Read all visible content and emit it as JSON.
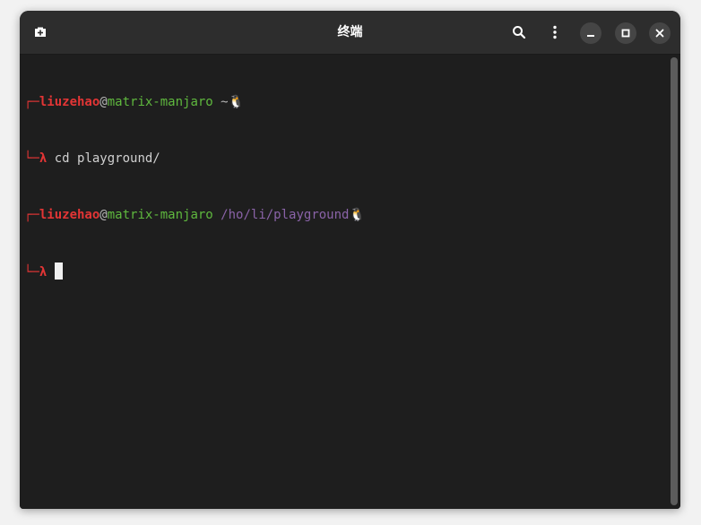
{
  "window": {
    "title": "终端"
  },
  "headerbar": {
    "new_tab_icon": "new-tab-icon",
    "search_icon": "search-icon",
    "menu_icon": "kebab-menu-icon",
    "minimize_icon": "minimize-icon",
    "maximize_icon": "maximize-icon",
    "close_icon": "close-icon"
  },
  "terminal": {
    "lines": [
      {
        "corner": "┌─",
        "user": "liuzehao",
        "at": "@",
        "host": "matrix-manjaro",
        "path": " ~",
        "suffix": "🐧"
      },
      {
        "corner": "└─",
        "prompt": "λ",
        "command": " cd playground/"
      },
      {
        "corner": "┌─",
        "user": "liuzehao",
        "at": "@",
        "host": "matrix-manjaro",
        "path": " /ho/li/playground",
        "suffix": "🐧"
      },
      {
        "corner": "└─",
        "prompt": "λ",
        "command": " "
      }
    ]
  },
  "colors": {
    "user": "#e23535",
    "host": "#5fb83e",
    "path_home": "#b5b5b5",
    "path_dir": "#8a63a8",
    "background": "#1e1e1e"
  }
}
